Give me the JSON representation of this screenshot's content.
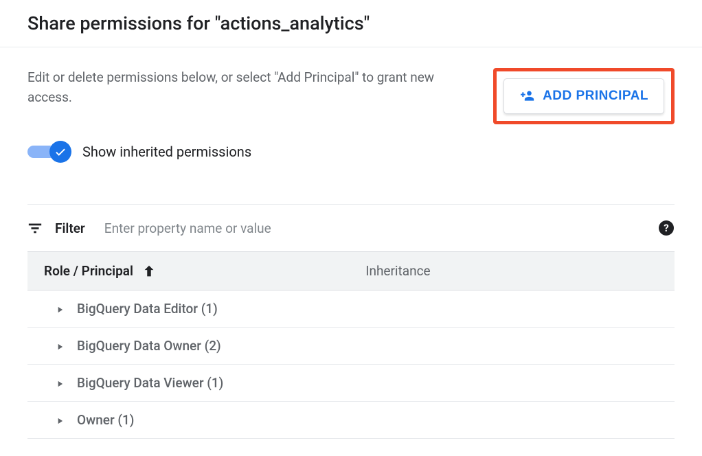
{
  "header": {
    "title": "Share permissions for \"actions_analytics\""
  },
  "description": "Edit or delete permissions below, or select \"Add Principal\" to grant new access.",
  "addPrincipalButton": "ADD PRINCIPAL",
  "toggle": {
    "label": "Show inherited permissions",
    "on": true
  },
  "filter": {
    "label": "Filter",
    "placeholder": "Enter property name or value"
  },
  "table": {
    "columns": {
      "role": "Role / Principal",
      "inheritance": "Inheritance"
    },
    "rows": [
      {
        "label": "BigQuery Data Editor (1)"
      },
      {
        "label": "BigQuery Data Owner (2)"
      },
      {
        "label": "BigQuery Data Viewer (1)"
      },
      {
        "label": "Owner (1)"
      }
    ]
  }
}
